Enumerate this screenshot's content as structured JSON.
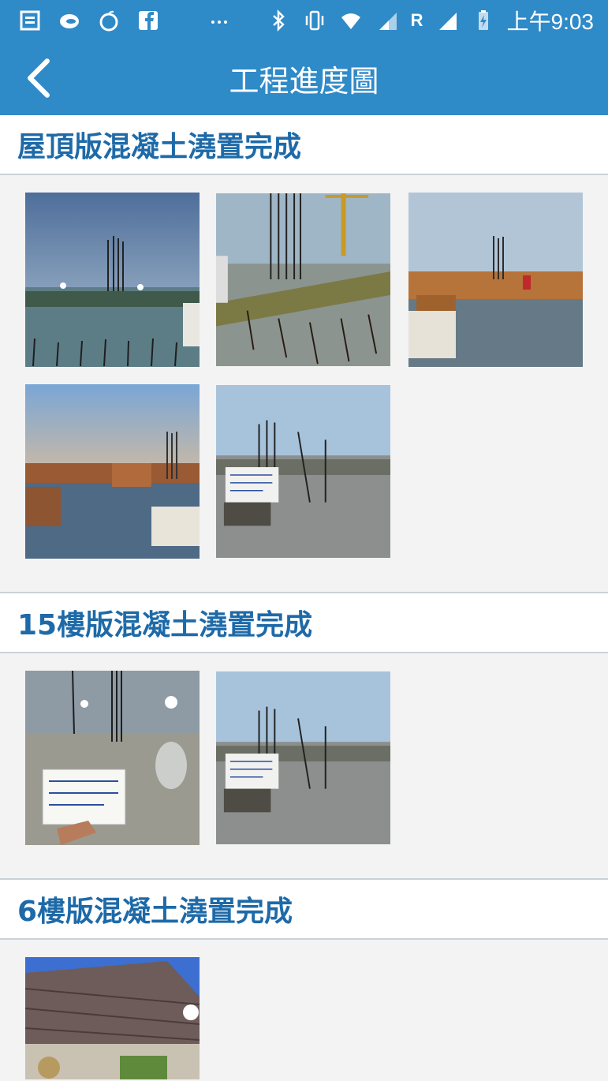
{
  "status_bar": {
    "time": "上午9:03",
    "roaming": "R",
    "icons": [
      "news-icon",
      "cloud-icon",
      "apple-icon",
      "facebook-icon",
      "more-icon",
      "bluetooth-icon",
      "vibrate-icon",
      "wifi-icon",
      "signal-icon",
      "signal-icon-2",
      "battery-icon"
    ]
  },
  "app_bar": {
    "title": "工程進度圖"
  },
  "sections": [
    {
      "title": "屋頂版混凝土澆置完成",
      "photo_count": 5
    },
    {
      "title": "15樓版混凝土澆置完成",
      "photo_count": 2
    },
    {
      "title": "6樓版混凝土澆置完成",
      "photo_count": 1
    }
  ],
  "colors": {
    "primary": "#2f8ac8",
    "section_text": "#1e6aa8",
    "background": "#f3f3f3"
  }
}
